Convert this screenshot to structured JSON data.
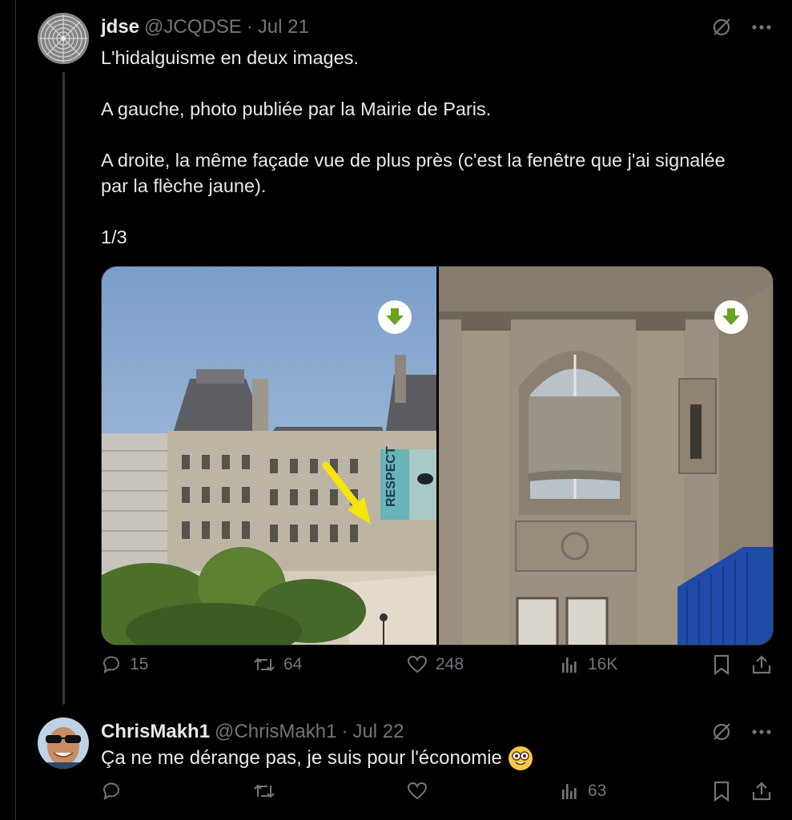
{
  "tweet": {
    "author_name": "jdse",
    "author_handle": "@JCQDSE",
    "separator": "·",
    "date": "Jul 21",
    "lines": [
      "L'hidalguisme en deux images.",
      "A gauche, photo publiée par la Mairie de Paris.",
      "A droite, la même façade vue de plus près (c'est la fenêtre que j'ai signalée",
      "par la flèche jaune).",
      "1/3"
    ],
    "poster_text": "RESPECT",
    "replies": "15",
    "reposts": "64",
    "likes": "248",
    "views": "16K"
  },
  "reply": {
    "author_name": "ChrisMakh1",
    "author_handle": "@ChrisMakh1",
    "separator": "·",
    "date": "Jul 22",
    "text": "Ça ne me dérange pas, je suis pour l'économie",
    "views": "63"
  },
  "colors": {
    "background": "#000000",
    "text": "#e7e9ea",
    "muted": "#71767b",
    "download_badge": "#6aa121",
    "arrow_yellow": "#f5e50a"
  }
}
